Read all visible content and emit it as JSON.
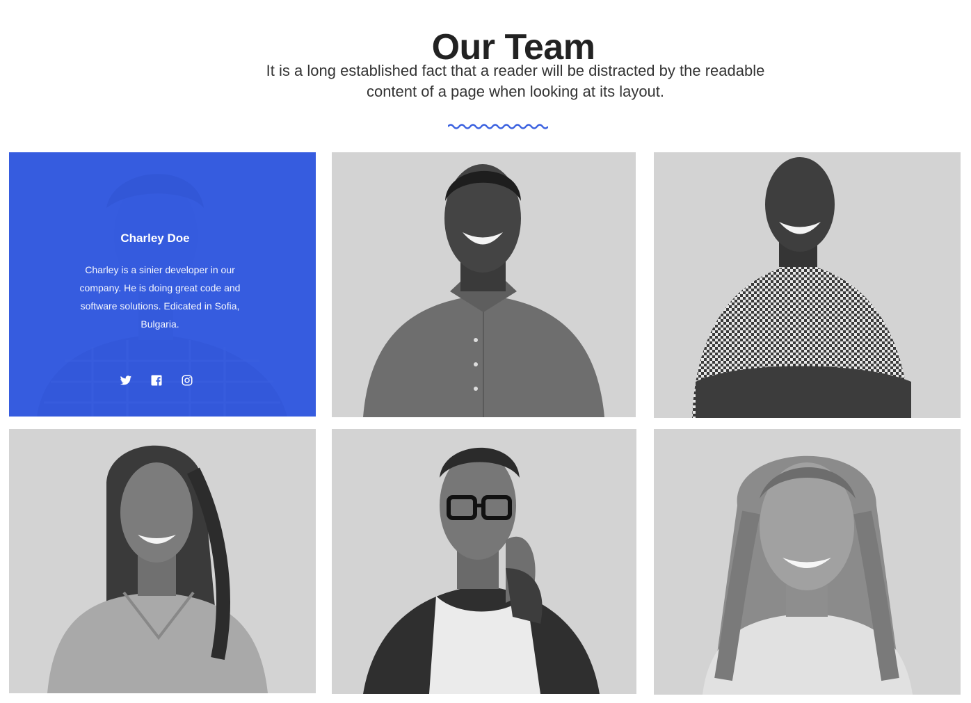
{
  "header": {
    "title": "Our Team",
    "subtitle": "It is a long established fact that a reader will be distracted by the readable content of a page when looking at its layout."
  },
  "colors": {
    "accent": "#3d63e0",
    "card_background": "#d3d3d3",
    "heading": "#222222"
  },
  "team": [
    {
      "name": "Charley Doe",
      "bio": "Charley is a sinier developer in our company. He is doing great code and software solutions. Edicated in Sofia, Bulgaria.",
      "socials": [
        "twitter-icon",
        "facebook-icon",
        "instagram-icon"
      ],
      "photo": "man-plaid-shirt"
    },
    {
      "photo": "man-button-shirt"
    },
    {
      "photo": "man-checkered-shirt-arms-crossed"
    },
    {
      "photo": "woman-long-hair-sweater"
    },
    {
      "photo": "man-glasses-phone"
    },
    {
      "photo": "woman-smiling-long-hair"
    }
  ]
}
